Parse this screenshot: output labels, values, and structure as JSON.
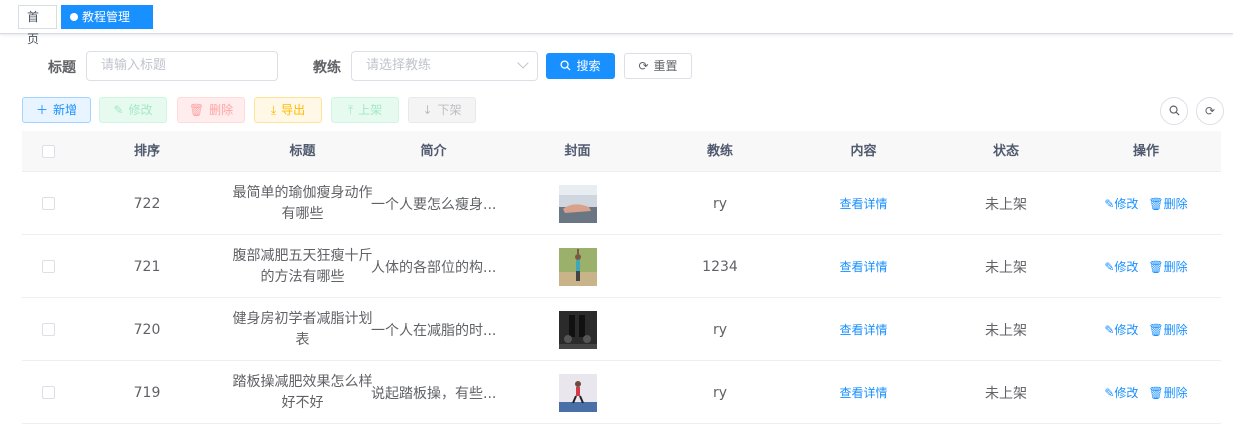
{
  "tags": {
    "home": "首页",
    "active": "教程管理",
    "close": "×"
  },
  "search": {
    "title_label": "标题",
    "title_placeholder": "请输入标题",
    "coach_label": "教练",
    "coach_placeholder": "请选择教练",
    "search_button": "搜索",
    "reset_button": "重置"
  },
  "toolbar": {
    "add": "新增",
    "edit": "修改",
    "delete": "删除",
    "export": "导出",
    "on_shelf": "上架",
    "off_shelf": "下架"
  },
  "table": {
    "headers": {
      "order": "排序",
      "title": "标题",
      "summary": "简介",
      "cover": "封面",
      "coach": "教练",
      "content": "内容",
      "status": "状态",
      "actions": "操作"
    },
    "rows": [
      {
        "order": "722",
        "title": "最简单的瑜伽瘦身动作有哪些",
        "summary": "一个人要怎么瘦身...",
        "coach": "ry",
        "content": "查看详情",
        "status": "未上架",
        "edit": "修改",
        "delete": "删除"
      },
      {
        "order": "721",
        "title": "腹部减肥五天狂瘦十斤的方法有哪些",
        "summary": "人体的各部位的构...",
        "coach": "1234",
        "content": "查看详情",
        "status": "未上架",
        "edit": "修改",
        "delete": "删除"
      },
      {
        "order": "720",
        "title": "健身房初学者减脂计划表",
        "summary": "一个人在减脂的时...",
        "coach": "ry",
        "content": "查看详情",
        "status": "未上架",
        "edit": "修改",
        "delete": "删除"
      },
      {
        "order": "719",
        "title": "踏板操减肥效果怎么样 好不好",
        "summary": "说起踏板操，有些...",
        "coach": "ry",
        "content": "查看详情",
        "status": "未上架",
        "edit": "修改",
        "delete": "删除"
      }
    ]
  }
}
